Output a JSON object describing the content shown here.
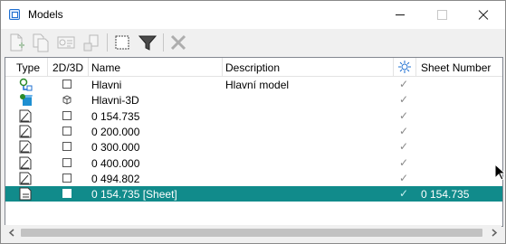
{
  "window": {
    "title": "Models"
  },
  "toolbar": {
    "buttons": [
      {
        "icon": "new-model-icon",
        "enabled": false
      },
      {
        "icon": "copy-model-icon",
        "enabled": false
      },
      {
        "icon": "properties-icon",
        "enabled": false
      },
      {
        "icon": "import-icon",
        "enabled": false
      },
      {
        "icon": "select-all-icon",
        "enabled": true
      },
      {
        "icon": "filter-icon",
        "enabled": true
      },
      {
        "icon": "delete-icon",
        "enabled": false
      }
    ]
  },
  "columns": {
    "type": "Type",
    "dim": "2D/3D",
    "name": "Name",
    "description": "Description",
    "sheet_number": "Sheet Number"
  },
  "rows": [
    {
      "type_icon": "design-model-icon",
      "dim_icon": "2d-icon",
      "name": "Hlavni",
      "description": "Hlavní model",
      "check": "✓",
      "sheet_number": ""
    },
    {
      "type_icon": "3d-model-icon",
      "dim_icon": "3d-icon",
      "name": "Hlavni-3D",
      "description": "",
      "check": "✓",
      "sheet_number": ""
    },
    {
      "type_icon": "drawing-icon",
      "dim_icon": "2d-icon",
      "name": "0 154.735",
      "description": "",
      "check": "✓",
      "sheet_number": ""
    },
    {
      "type_icon": "drawing-icon",
      "dim_icon": "2d-icon",
      "name": "0 200.000",
      "description": "",
      "check": "✓",
      "sheet_number": ""
    },
    {
      "type_icon": "drawing-icon",
      "dim_icon": "2d-icon",
      "name": "0 300.000",
      "description": "",
      "check": "✓",
      "sheet_number": ""
    },
    {
      "type_icon": "drawing-icon",
      "dim_icon": "2d-icon",
      "name": "0 400.000",
      "description": "",
      "check": "✓",
      "sheet_number": ""
    },
    {
      "type_icon": "drawing-icon",
      "dim_icon": "2d-icon",
      "name": "0 494.802",
      "description": "",
      "check": "✓",
      "sheet_number": ""
    },
    {
      "type_icon": "sheet-icon",
      "dim_icon": "2d-icon",
      "name": "0 154.735 [Sheet]",
      "description": "",
      "check": "✓",
      "sheet_number": "0 154.735",
      "selected": true
    }
  ],
  "colors": {
    "selection": "#118b8b",
    "accent": "#1e6fd1"
  }
}
